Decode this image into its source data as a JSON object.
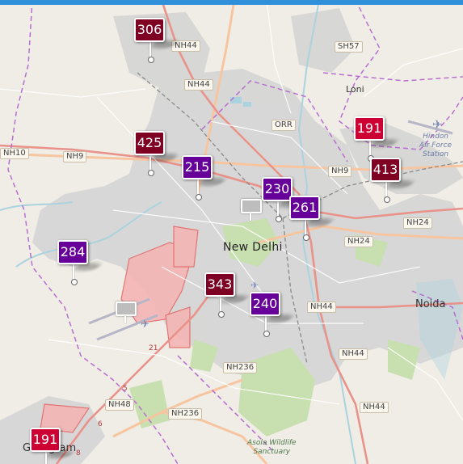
{
  "map": {
    "city_label": "New Delhi",
    "towns": [
      {
        "id": "loni",
        "text": "Loni"
      },
      {
        "id": "noida",
        "text": "Noida"
      },
      {
        "id": "gurugram",
        "text": "Gurugram"
      }
    ],
    "roads": [
      {
        "id": "nh44-top",
        "text": "NH44"
      },
      {
        "id": "sh57",
        "text": "SH57"
      },
      {
        "id": "nh44-north",
        "text": "NH44"
      },
      {
        "id": "orr",
        "text": "ORR"
      },
      {
        "id": "nh10",
        "text": "NH10"
      },
      {
        "id": "nh9-west",
        "text": "NH9"
      },
      {
        "id": "nh9-east",
        "text": "NH9"
      },
      {
        "id": "nh24-a",
        "text": "NH24"
      },
      {
        "id": "nh24-b",
        "text": "NH24"
      },
      {
        "id": "nh44-center",
        "text": "NH44"
      },
      {
        "id": "nh44-se",
        "text": "NH44"
      },
      {
        "id": "nh236-a",
        "text": "NH236"
      },
      {
        "id": "nh48",
        "text": "NH48"
      },
      {
        "id": "nh236-b",
        "text": "NH236"
      },
      {
        "id": "nh44-south",
        "text": "NH44"
      }
    ],
    "airport_label": [
      "Hindon",
      "Air Force",
      "Station"
    ],
    "park_label": [
      "Asola Wildlife",
      "Sanctuary"
    ],
    "km_markers": [
      "21",
      "5",
      "6",
      "8"
    ],
    "aqi_markers": [
      {
        "value": "306",
        "level": "hazardous",
        "color": "#7e0023"
      },
      {
        "value": "425",
        "level": "hazardous",
        "color": "#7e0023"
      },
      {
        "value": "215",
        "level": "very-unhealthy",
        "color": "#660099"
      },
      {
        "value": "230",
        "level": "very-unhealthy",
        "color": "#660099"
      },
      {
        "value": "261",
        "level": "very-unhealthy",
        "color": "#660099"
      },
      {
        "value": "191",
        "level": "unhealthy",
        "color": "#cc0033"
      },
      {
        "value": "413",
        "level": "hazardous",
        "color": "#7e0023"
      },
      {
        "value": "284",
        "level": "very-unhealthy",
        "color": "#660099"
      },
      {
        "value": "343",
        "level": "hazardous",
        "color": "#7e0023"
      },
      {
        "value": "240",
        "level": "very-unhealthy",
        "color": "#660099"
      },
      {
        "value": "191",
        "level": "unhealthy",
        "color": "#cc0033"
      }
    ],
    "colors": {
      "land": "#f0ede6",
      "urban": "#d4d4d4",
      "highway": "#e8928a",
      "trunk": "#f7c59f",
      "boundary": "#b76fcf",
      "water": "#aad3df",
      "green": "#c8dfb0",
      "restricted": "#f2a9a9"
    }
  }
}
